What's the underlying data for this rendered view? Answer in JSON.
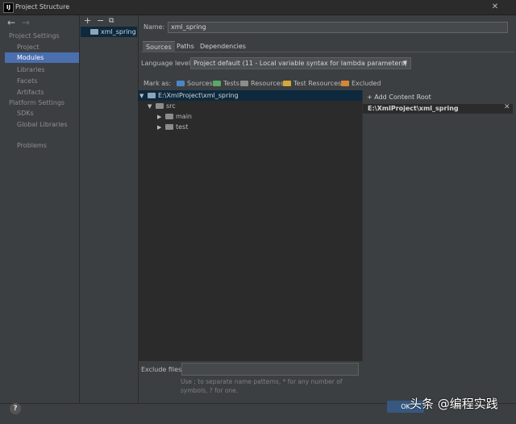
{
  "window": {
    "title": "Project Structure",
    "app_icon": "IJ",
    "close_label": "✕"
  },
  "nav": {
    "back": "←",
    "forward": "→"
  },
  "sidebar": {
    "project_settings_header": "Project Settings",
    "project_items": [
      "Project",
      "Modules",
      "Libraries",
      "Facets",
      "Artifacts"
    ],
    "platform_settings_header": "Platform Settings",
    "platform_items": [
      "SDKs",
      "Global Libraries"
    ],
    "problems": "Problems",
    "selected": "Modules"
  },
  "module_toolbar": {
    "add": "+",
    "remove": "−",
    "copy": "⧉"
  },
  "modules": [
    "xml_spring"
  ],
  "name_field": {
    "label": "Name:",
    "value": "xml_spring"
  },
  "tabs": [
    "Sources",
    "Paths",
    "Dependencies"
  ],
  "active_tab": "Sources",
  "language_level": {
    "label": "Language level:",
    "value": "Project default (11 - Local variable syntax for lambda parameters)"
  },
  "mark_as": {
    "label": "Mark as:",
    "items": [
      {
        "label": "Sources",
        "color": "#4a87c7"
      },
      {
        "label": "Tests",
        "color": "#59a869"
      },
      {
        "label": "Resources",
        "color": "#8c8c8c"
      },
      {
        "label": "Test Resources",
        "color": "#d6a83a"
      },
      {
        "label": "Excluded",
        "color": "#d6863a"
      }
    ]
  },
  "tree": {
    "root": "E:\\XmlProject\\xml_spring",
    "src": "src",
    "children": [
      "main",
      "test"
    ]
  },
  "content_roots": {
    "add_label": "+ Add Content Root",
    "root_path": "E:\\XmlProject\\xml_spring",
    "remove": "✕"
  },
  "exclude": {
    "label": "Exclude files:",
    "value": "",
    "hint": "Use ; to separate name patterns, * for any number of symbols, ? for one."
  },
  "footer": {
    "help": "?",
    "ok": "OK"
  },
  "watermark": "头条 @编程实践",
  "colors": {
    "accent": "#4b6eaf",
    "selection": "#0d293e",
    "background": "#3c3f41",
    "panel": "#2b2b2b"
  }
}
